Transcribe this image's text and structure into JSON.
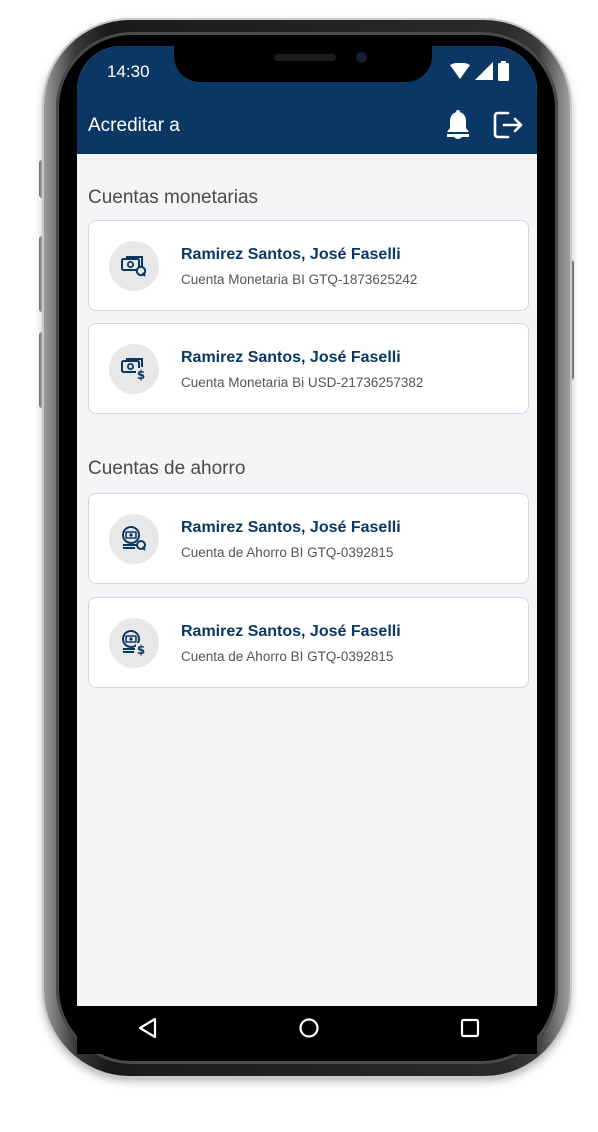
{
  "status_bar": {
    "time": "14:30",
    "icons": [
      "wifi-icon",
      "signal-icon",
      "battery-icon"
    ]
  },
  "header": {
    "title": "Acreditar a",
    "actions": [
      "bell-icon",
      "logout-icon"
    ]
  },
  "colors": {
    "primary": "#0a3764",
    "background": "#f4f5f7",
    "card_border": "#cfd7e3"
  },
  "sections": [
    {
      "title": "Cuentas monetarias",
      "accounts": [
        {
          "name": "Ramirez Santos, José Faselli",
          "number": "Cuenta Monetaria BI GTQ-1873625242",
          "icon": "money-quetzal-icon"
        },
        {
          "name": "Ramirez Santos, José Faselli",
          "number": "Cuenta Monetaria Bi USD-21736257382",
          "icon": "money-dollar-icon"
        }
      ]
    },
    {
      "title": "Cuentas de ahorro",
      "accounts": [
        {
          "name": "Ramirez Santos, José Faselli",
          "number": "Cuenta de Ahorro BI GTQ-0392815",
          "icon": "savings-quetzal-icon"
        },
        {
          "name": "Ramirez Santos, José Faselli",
          "number": "Cuenta de Ahorro BI GTQ-0392815",
          "icon": "savings-dollar-icon"
        }
      ]
    }
  ],
  "nav_bar": [
    "back-icon",
    "home-icon",
    "recents-icon"
  ]
}
